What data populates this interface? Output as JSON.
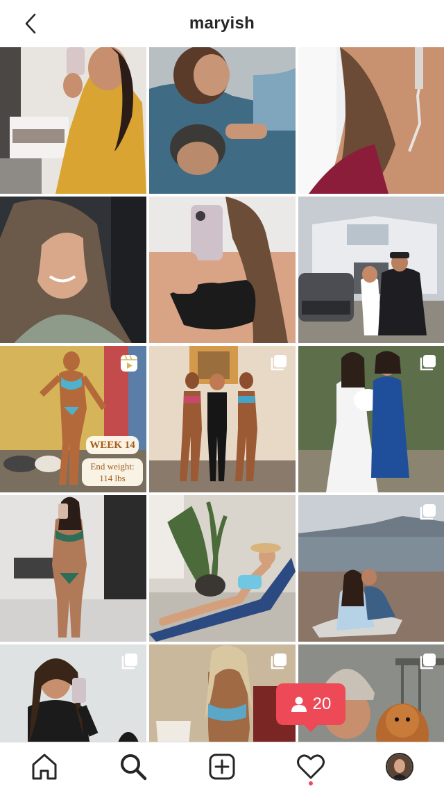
{
  "header": {
    "title": "maryish"
  },
  "posts": [
    {
      "scene": "mirror-selfie-yellow-dress",
      "type": "single"
    },
    {
      "scene": "couple-lying-on-rug",
      "type": "single"
    },
    {
      "scene": "earring-closeup",
      "type": "single"
    },
    {
      "scene": "car-selfie",
      "type": "single"
    },
    {
      "scene": "mirror-selfie-black-top",
      "type": "single"
    },
    {
      "scene": "couple-new-house",
      "type": "single"
    },
    {
      "scene": "bikini-competition-progress",
      "type": "video",
      "captions": [
        "WEEK 14",
        "End weight:",
        "114 lbs"
      ]
    },
    {
      "scene": "three-competitors",
      "type": "carousel"
    },
    {
      "scene": "bride-with-mother",
      "type": "carousel"
    },
    {
      "scene": "bikini-mirror-selfie",
      "type": "single"
    },
    {
      "scene": "lounge-chair-pool",
      "type": "single"
    },
    {
      "scene": "beach-couple-kiss",
      "type": "carousel"
    },
    {
      "scene": "mirror-selfie-jacket",
      "type": "carousel"
    },
    {
      "scene": "blue-bikini-stage",
      "type": "carousel"
    },
    {
      "scene": "beanie-with-dog",
      "type": "carousel"
    }
  ],
  "notification": {
    "icon": "person-icon",
    "count": "20"
  },
  "nav": {
    "items": [
      {
        "icon": "home-icon"
      },
      {
        "icon": "search-icon",
        "active": true
      },
      {
        "icon": "add-post-icon"
      },
      {
        "icon": "heart-icon",
        "has_activity": true
      },
      {
        "icon": "profile-avatar"
      }
    ]
  },
  "colors": {
    "accent": "#ed4956",
    "text": "#262626",
    "divider": "#dbdbdb"
  }
}
